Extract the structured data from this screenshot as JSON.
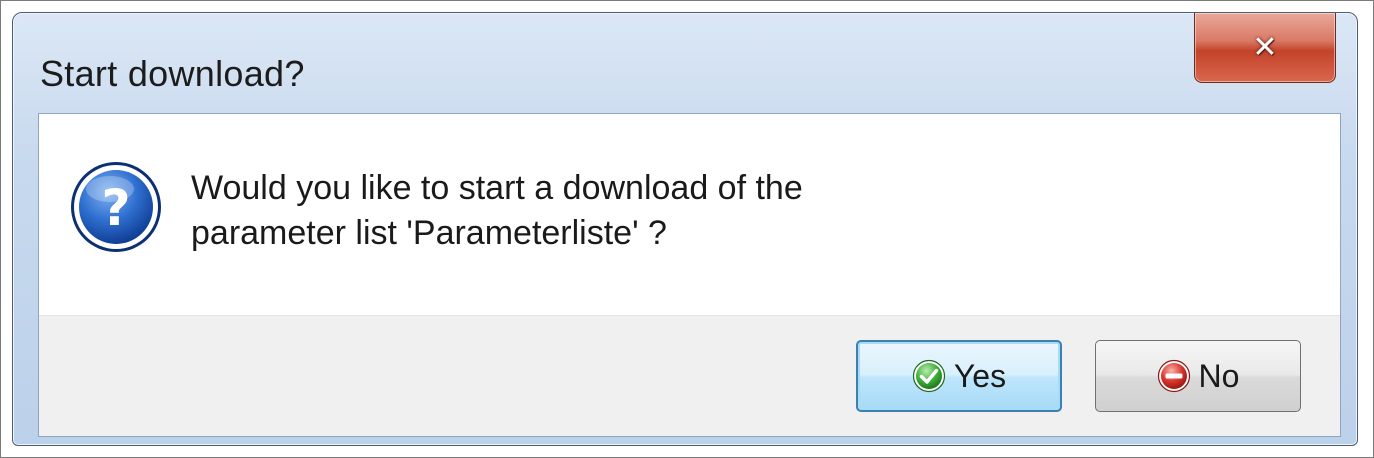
{
  "dialog": {
    "title": "Start download?",
    "close_icon": "close-icon",
    "icon": "question-icon",
    "message_line1": "Would you like to start a download of the",
    "message_line2": "parameter list 'Parameterliste' ?",
    "buttons": {
      "yes_label": "Yes",
      "yes_icon": "check-icon",
      "no_label": "No",
      "no_icon": "minus-icon"
    }
  },
  "colors": {
    "title_bar": "#c7d9ee",
    "close_button": "#c3432a",
    "default_button_border": "#3c7fb1",
    "yes_icon": "#3fae3a",
    "no_icon": "#d9342b",
    "question_icon": "#1c5fc4"
  }
}
